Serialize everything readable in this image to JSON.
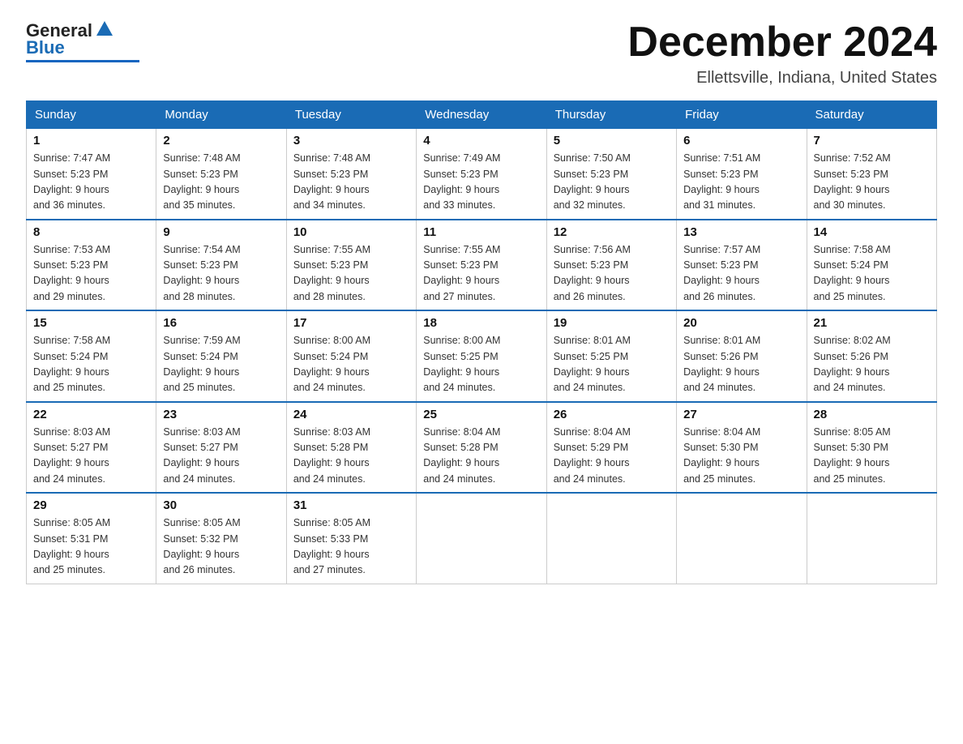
{
  "header": {
    "logo_general": "General",
    "logo_blue": "Blue",
    "month_title": "December 2024",
    "location": "Ellettsville, Indiana, United States"
  },
  "days_of_week": [
    "Sunday",
    "Monday",
    "Tuesday",
    "Wednesday",
    "Thursday",
    "Friday",
    "Saturday"
  ],
  "weeks": [
    [
      {
        "day": "1",
        "sunrise": "7:47 AM",
        "sunset": "5:23 PM",
        "daylight": "9 hours and 36 minutes."
      },
      {
        "day": "2",
        "sunrise": "7:48 AM",
        "sunset": "5:23 PM",
        "daylight": "9 hours and 35 minutes."
      },
      {
        "day": "3",
        "sunrise": "7:48 AM",
        "sunset": "5:23 PM",
        "daylight": "9 hours and 34 minutes."
      },
      {
        "day": "4",
        "sunrise": "7:49 AM",
        "sunset": "5:23 PM",
        "daylight": "9 hours and 33 minutes."
      },
      {
        "day": "5",
        "sunrise": "7:50 AM",
        "sunset": "5:23 PM",
        "daylight": "9 hours and 32 minutes."
      },
      {
        "day": "6",
        "sunrise": "7:51 AM",
        "sunset": "5:23 PM",
        "daylight": "9 hours and 31 minutes."
      },
      {
        "day": "7",
        "sunrise": "7:52 AM",
        "sunset": "5:23 PM",
        "daylight": "9 hours and 30 minutes."
      }
    ],
    [
      {
        "day": "8",
        "sunrise": "7:53 AM",
        "sunset": "5:23 PM",
        "daylight": "9 hours and 29 minutes."
      },
      {
        "day": "9",
        "sunrise": "7:54 AM",
        "sunset": "5:23 PM",
        "daylight": "9 hours and 28 minutes."
      },
      {
        "day": "10",
        "sunrise": "7:55 AM",
        "sunset": "5:23 PM",
        "daylight": "9 hours and 28 minutes."
      },
      {
        "day": "11",
        "sunrise": "7:55 AM",
        "sunset": "5:23 PM",
        "daylight": "9 hours and 27 minutes."
      },
      {
        "day": "12",
        "sunrise": "7:56 AM",
        "sunset": "5:23 PM",
        "daylight": "9 hours and 26 minutes."
      },
      {
        "day": "13",
        "sunrise": "7:57 AM",
        "sunset": "5:23 PM",
        "daylight": "9 hours and 26 minutes."
      },
      {
        "day": "14",
        "sunrise": "7:58 AM",
        "sunset": "5:24 PM",
        "daylight": "9 hours and 25 minutes."
      }
    ],
    [
      {
        "day": "15",
        "sunrise": "7:58 AM",
        "sunset": "5:24 PM",
        "daylight": "9 hours and 25 minutes."
      },
      {
        "day": "16",
        "sunrise": "7:59 AM",
        "sunset": "5:24 PM",
        "daylight": "9 hours and 25 minutes."
      },
      {
        "day": "17",
        "sunrise": "8:00 AM",
        "sunset": "5:24 PM",
        "daylight": "9 hours and 24 minutes."
      },
      {
        "day": "18",
        "sunrise": "8:00 AM",
        "sunset": "5:25 PM",
        "daylight": "9 hours and 24 minutes."
      },
      {
        "day": "19",
        "sunrise": "8:01 AM",
        "sunset": "5:25 PM",
        "daylight": "9 hours and 24 minutes."
      },
      {
        "day": "20",
        "sunrise": "8:01 AM",
        "sunset": "5:26 PM",
        "daylight": "9 hours and 24 minutes."
      },
      {
        "day": "21",
        "sunrise": "8:02 AM",
        "sunset": "5:26 PM",
        "daylight": "9 hours and 24 minutes."
      }
    ],
    [
      {
        "day": "22",
        "sunrise": "8:03 AM",
        "sunset": "5:27 PM",
        "daylight": "9 hours and 24 minutes."
      },
      {
        "day": "23",
        "sunrise": "8:03 AM",
        "sunset": "5:27 PM",
        "daylight": "9 hours and 24 minutes."
      },
      {
        "day": "24",
        "sunrise": "8:03 AM",
        "sunset": "5:28 PM",
        "daylight": "9 hours and 24 minutes."
      },
      {
        "day": "25",
        "sunrise": "8:04 AM",
        "sunset": "5:28 PM",
        "daylight": "9 hours and 24 minutes."
      },
      {
        "day": "26",
        "sunrise": "8:04 AM",
        "sunset": "5:29 PM",
        "daylight": "9 hours and 24 minutes."
      },
      {
        "day": "27",
        "sunrise": "8:04 AM",
        "sunset": "5:30 PM",
        "daylight": "9 hours and 25 minutes."
      },
      {
        "day": "28",
        "sunrise": "8:05 AM",
        "sunset": "5:30 PM",
        "daylight": "9 hours and 25 minutes."
      }
    ],
    [
      {
        "day": "29",
        "sunrise": "8:05 AM",
        "sunset": "5:31 PM",
        "daylight": "9 hours and 25 minutes."
      },
      {
        "day": "30",
        "sunrise": "8:05 AM",
        "sunset": "5:32 PM",
        "daylight": "9 hours and 26 minutes."
      },
      {
        "day": "31",
        "sunrise": "8:05 AM",
        "sunset": "5:33 PM",
        "daylight": "9 hours and 27 minutes."
      },
      null,
      null,
      null,
      null
    ]
  ]
}
